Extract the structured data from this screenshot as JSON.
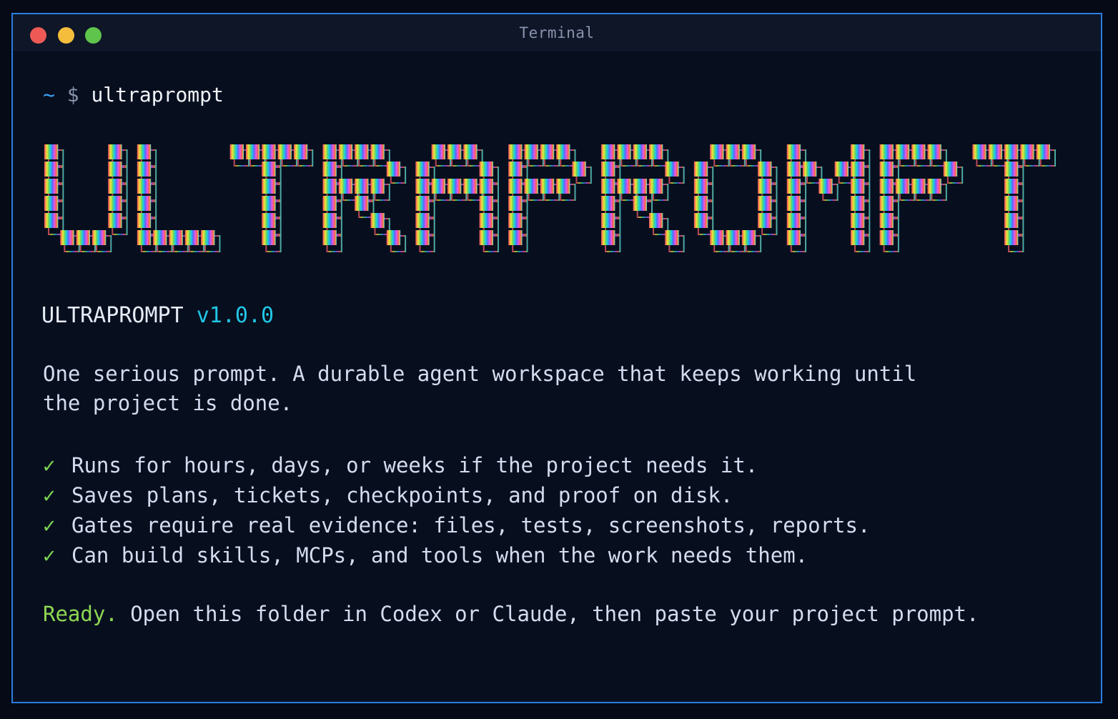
{
  "window": {
    "title": "Terminal"
  },
  "prompt": {
    "tilde": "~",
    "dollar": "$",
    "command": "ultraprompt"
  },
  "banner": {
    "text": "ULTRAPROMPT",
    "colors": [
      "#f2536c",
      "#f4844a",
      "#f2d43a",
      "#c9e84a",
      "#7ed552",
      "#33d6a2",
      "#22c6e6",
      "#3a8df5",
      "#7a5cf2",
      "#c35cf2",
      "#f25cc0",
      "#f2536c",
      "#f29a3a",
      "#4ee6e6"
    ]
  },
  "version_line": {
    "name": "ULTRAPROMPT",
    "version": "v1.0.0"
  },
  "description": {
    "line1": "One serious prompt. A durable agent workspace that keeps working until",
    "line2": "the project is done."
  },
  "checks": {
    "icon": "✓",
    "items": [
      "Runs for hours, days, or weeks if the project needs it.",
      "Saves plans, tickets, checkpoints, and proof on disk.",
      "Gates require real evidence: files, tests, screenshots, reports.",
      "Can build skills, MCPs, and tools when the work needs them."
    ]
  },
  "ready_line": {
    "ready": "Ready.",
    "message": " Open this folder in Codex or Claude, then paste your project prompt."
  }
}
